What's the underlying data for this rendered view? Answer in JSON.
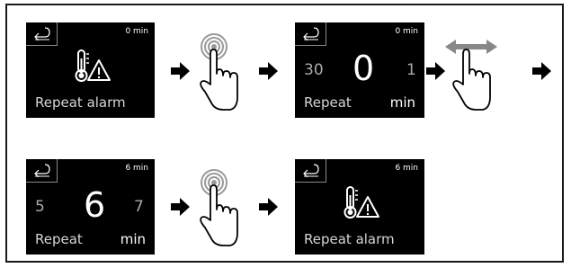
{
  "steps_row1": [
    {
      "time": "0 min",
      "caption": "Repeat alarm"
    },
    {
      "time": "0 min",
      "left": "30",
      "center": "0",
      "right": "1",
      "caption": "Repeat",
      "unit": "min"
    }
  ],
  "steps_row2": [
    {
      "time": "6 min",
      "left": "5",
      "center": "6",
      "right": "7",
      "caption": "Repeat",
      "unit": "min"
    },
    {
      "time": "6 min",
      "caption": "Repeat alarm"
    }
  ],
  "icons": {
    "back": "back-arrow-icon",
    "alarm": "temperature-alarm-icon",
    "tap": "tap-gesture-icon",
    "swipe": "swipe-gesture-icon",
    "arrow": "right-arrow-icon"
  },
  "colors": {
    "screen": "#000000",
    "swipe_arrow": "#888888"
  }
}
